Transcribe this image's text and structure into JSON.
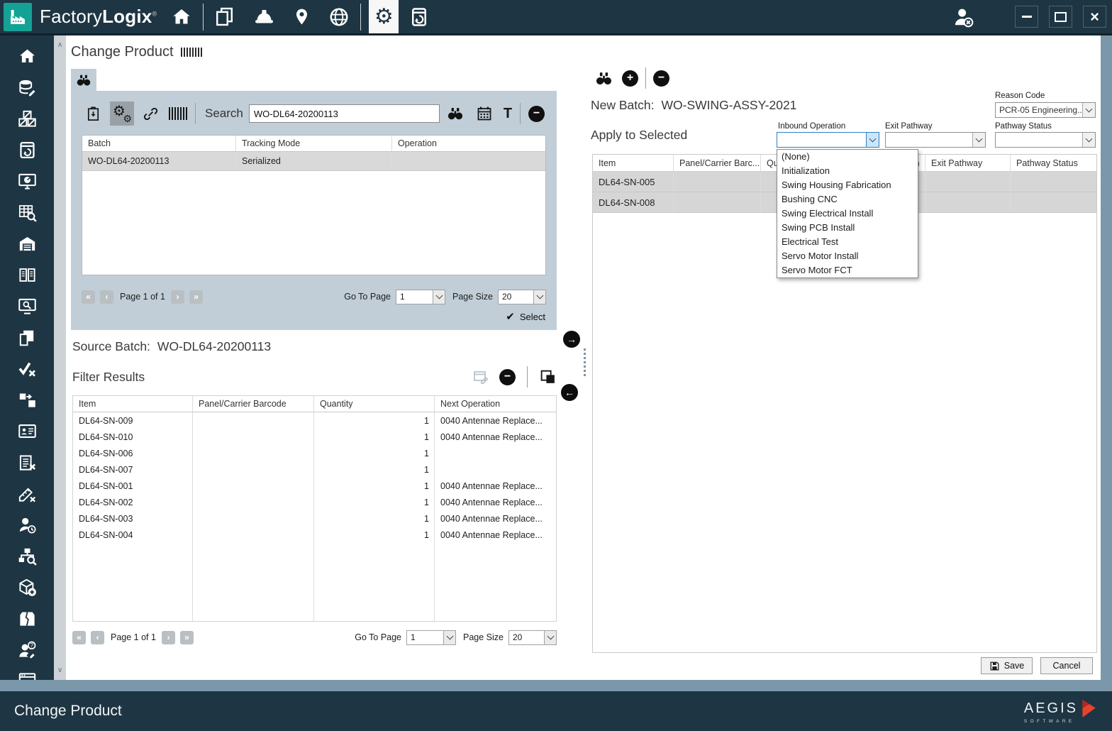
{
  "colors": {
    "chrome": "#1e3543",
    "accent_teal": "#15a296",
    "panel_blue_gray": "#c1ced7",
    "steel_edge": "#7b98ab",
    "selected_row": "#d9d9d9",
    "focus_blue": "#2e7fc2",
    "aegis_red": "#e8432e"
  },
  "icons": {
    "gear": "⚙",
    "check": "✔",
    "plus": "+",
    "minus": "−",
    "arrow_right": "→",
    "arrow_left": "←",
    "text_tool": "T",
    "page_first": "«",
    "page_prev": "‹",
    "page_next": "›",
    "page_last": "»",
    "scroll_up": "∧",
    "scroll_down": "∨",
    "close": "×"
  },
  "titlebar": {
    "brand_regular": "Factory",
    "brand_bold": "Logix",
    "brand_mark": "®",
    "nav_icons": [
      "home",
      "documents",
      "operator-hardhat",
      "location-pin",
      "globe",
      "settings-gear",
      "device-restore"
    ],
    "window_icons": [
      "user-logout",
      "minimize",
      "maximize",
      "close"
    ]
  },
  "sidebar": {
    "items": [
      "home",
      "database-edit",
      "crates",
      "batch-restore",
      "dashboard-monitor",
      "table-search",
      "warehouse",
      "book",
      "monitor-search",
      "copy-pages",
      "check-x",
      "box-transfer",
      "id-card",
      "clipboard-x",
      "ruler-x",
      "user-clock",
      "hierarchy-search",
      "cube-plus",
      "box-broken",
      "user-question",
      "app-window"
    ]
  },
  "page": {
    "title": "Change Product"
  },
  "search_panel": {
    "toolbar": {
      "search_label": "Search",
      "search_value": "WO-DL64-20200113"
    },
    "batch_table": {
      "columns": [
        "Batch",
        "Tracking Mode",
        "Operation"
      ],
      "rows": [
        {
          "batch": "WO-DL64-20200113",
          "tracking_mode": "Serialized",
          "operation": ""
        }
      ]
    },
    "pagination": {
      "page_text": "Page 1 of 1",
      "goto_label": "Go To Page",
      "goto_value": "1",
      "size_label": "Page Size",
      "size_value": "20"
    },
    "select_label": "Select"
  },
  "source_batch": {
    "label": "Source Batch:",
    "value": "WO-DL64-20200113"
  },
  "filter_results": {
    "title": "Filter Results",
    "columns": [
      "Item",
      "Panel/Carrier Barcode",
      "Quantity",
      "Next Operation"
    ],
    "rows": [
      {
        "item": "DL64-SN-009",
        "barcode": "",
        "qty": "1",
        "next_op": "0040 Antennae Replace..."
      },
      {
        "item": "DL64-SN-010",
        "barcode": "",
        "qty": "1",
        "next_op": "0040 Antennae Replace..."
      },
      {
        "item": "DL64-SN-006",
        "barcode": "",
        "qty": "1",
        "next_op": ""
      },
      {
        "item": "DL64-SN-007",
        "barcode": "",
        "qty": "1",
        "next_op": ""
      },
      {
        "item": "DL64-SN-001",
        "barcode": "",
        "qty": "1",
        "next_op": "0040 Antennae Replace..."
      },
      {
        "item": "DL64-SN-002",
        "barcode": "",
        "qty": "1",
        "next_op": "0040 Antennae Replace..."
      },
      {
        "item": "DL64-SN-003",
        "barcode": "",
        "qty": "1",
        "next_op": "0040 Antennae Replace..."
      },
      {
        "item": "DL64-SN-004",
        "barcode": "",
        "qty": "1",
        "next_op": "0040 Antennae Replace..."
      }
    ],
    "pagination": {
      "page_text": "Page 1 of 1",
      "goto_label": "Go To Page",
      "goto_value": "1",
      "size_label": "Page Size",
      "size_value": "20"
    }
  },
  "right_panel": {
    "new_batch_label": "New Batch:",
    "new_batch_value": "WO-SWING-ASSY-2021",
    "reason_code_label": "Reason Code",
    "reason_code_value": "PCR-05 Engineering...",
    "apply_label": "Apply to Selected",
    "fields": {
      "inbound_label": "Inbound Operation",
      "inbound_value": "",
      "exit_label": "Exit Pathway",
      "exit_value": "",
      "status_label": "Pathway Status",
      "status_value": ""
    },
    "table": {
      "columns": [
        "Item",
        "Panel/Carrier Barc...",
        "Quantity",
        "Inbound Operation",
        "Exit Pathway",
        "Pathway Status"
      ],
      "rows": [
        {
          "item": "DL64-SN-005"
        },
        {
          "item": "DL64-SN-008"
        }
      ]
    },
    "dropdown_options": [
      "(None)",
      "Initialization",
      "Swing Housing Fabrication",
      "Bushing CNC",
      "Swing Electrical Install",
      "Swing PCB Install",
      "Electrical Test",
      "Servo Motor Install",
      "Servo Motor FCT"
    ],
    "save_label": "Save",
    "cancel_label": "Cancel"
  },
  "statusbar": {
    "title": "Change Product",
    "brand": "AEGIS",
    "brand_sub": "SOFTWARE"
  }
}
